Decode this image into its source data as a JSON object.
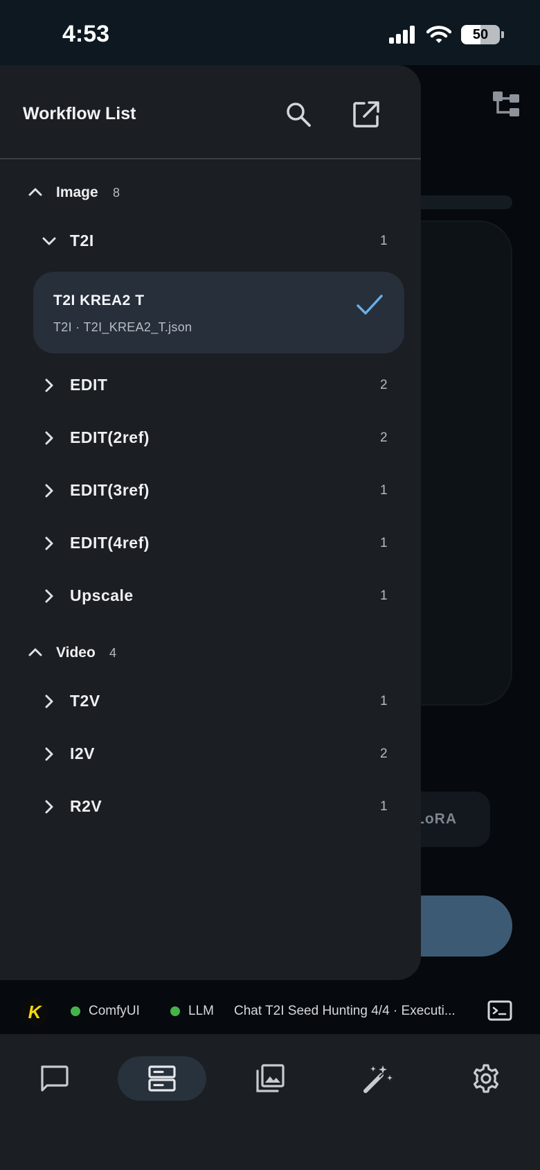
{
  "status_bar": {
    "time": "4:53",
    "battery": "50"
  },
  "background": {
    "chip_label": "LoRA"
  },
  "drawer": {
    "title": "Workflow List",
    "groups": [
      {
        "label": "Image",
        "count": "8"
      },
      {
        "label": "Video",
        "count": "4"
      }
    ],
    "categories": [
      {
        "label": "T2I",
        "count": "1"
      },
      {
        "label": "EDIT",
        "count": "2"
      },
      {
        "label": "EDIT(2ref)",
        "count": "2"
      },
      {
        "label": "EDIT(3ref)",
        "count": "1"
      },
      {
        "label": "EDIT(4ref)",
        "count": "1"
      },
      {
        "label": "Upscale",
        "count": "1"
      },
      {
        "label": "T2V",
        "count": "1"
      },
      {
        "label": "I2V",
        "count": "2"
      },
      {
        "label": "R2V",
        "count": "1"
      }
    ],
    "selected_workflow": {
      "name": "T2I KREA2 T",
      "subtitle": "T2I · T2I_KREA2_T.json"
    }
  },
  "status_strip": {
    "logo": "K",
    "services": [
      {
        "label": "ComfyUI",
        "color": "#45b34a"
      },
      {
        "label": "LLM",
        "color": "#45b34a"
      }
    ],
    "task": "Chat T2I Seed Hunting 4/4 · Executi..."
  },
  "nav": {
    "items": [
      "chat-icon",
      "workflows-icon",
      "gallery-icon",
      "magic-wand-icon",
      "gear-icon"
    ],
    "active": "workflows-icon"
  },
  "colors": {
    "accent": "#6aaee6",
    "drawer_bg": "#1b1e22",
    "selected_bg": "#262f3a"
  }
}
